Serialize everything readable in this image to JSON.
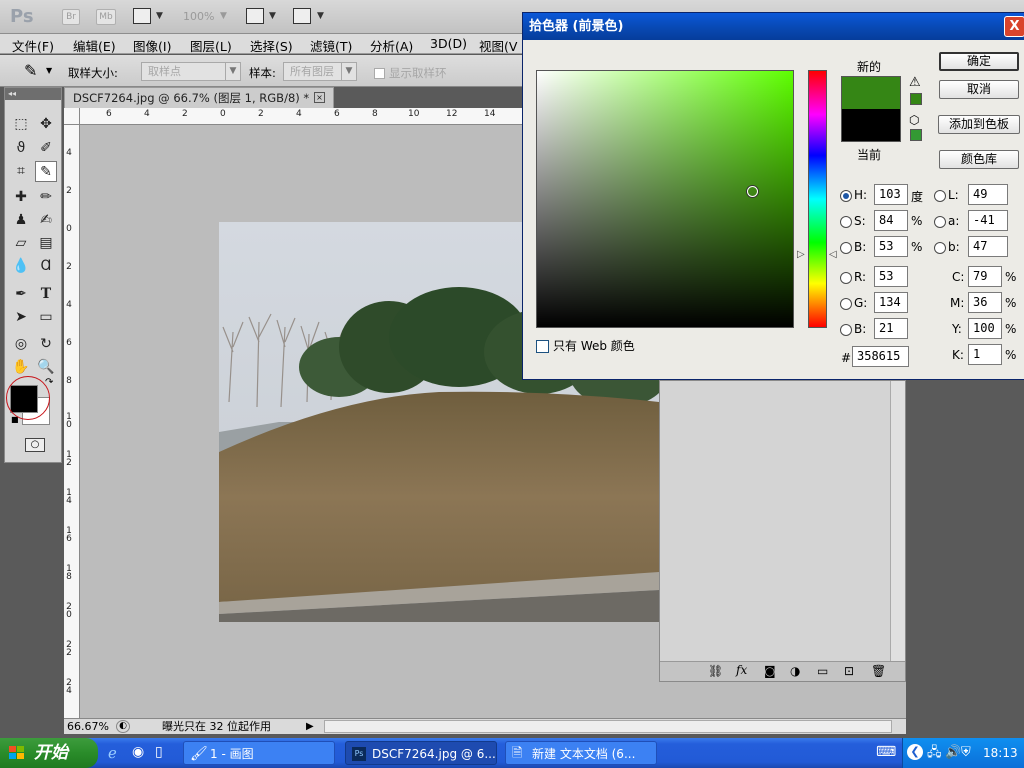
{
  "appbar": {
    "logo": "Ps",
    "btn_br": "Br",
    "btn_mb": "Mb",
    "zoom": "100%"
  },
  "menu": [
    "文件(F)",
    "编辑(E)",
    "图像(I)",
    "图层(L)",
    "选择(S)",
    "滤镜(T)",
    "分析(A)",
    "3D(D)",
    "视图(V"
  ],
  "options": {
    "sample_size_label": "取样大小:",
    "sample_size_value": "取样点",
    "sample_label": "样本:",
    "sample_value": "所有图层",
    "show_ring_label": "显示取样环"
  },
  "doc": {
    "tab_title": "DSCF7264.jpg @ 66.7% (图层 1, RGB/8) *"
  },
  "ruler": {
    "h": [
      "6",
      "4",
      "2",
      "0",
      "2",
      "4",
      "6",
      "8",
      "10",
      "12",
      "14"
    ],
    "v": [
      "4",
      "2",
      "0",
      "2",
      "4",
      "6",
      "8",
      "1\n0",
      "1\n2",
      "1\n4",
      "1\n6",
      "1\n8",
      "2\n0",
      "2\n2",
      "2\n4"
    ]
  },
  "status": {
    "zoom": "66.67%",
    "message": "曝光只在 32 位起作用"
  },
  "picker": {
    "title": "拾色器 (前景色)",
    "close": "X",
    "new_label": "新的",
    "current_label": "当前",
    "new_color": "#358615",
    "current_color": "#000000",
    "buttons": {
      "ok": "确定",
      "cancel": "取消",
      "add_swatch": "添加到色板",
      "libraries": "颜色库"
    },
    "web_only": "只有 Web 颜色",
    "h": {
      "label": "H:",
      "value": "103",
      "unit": "度"
    },
    "s": {
      "label": "S:",
      "value": "84",
      "unit": "%"
    },
    "bri": {
      "label": "B:",
      "value": "53",
      "unit": "%"
    },
    "r": {
      "label": "R:",
      "value": "53"
    },
    "g": {
      "label": "G:",
      "value": "134"
    },
    "bl": {
      "label": "B:",
      "value": "21"
    },
    "lab_l": {
      "label": "L:",
      "value": "49"
    },
    "lab_a": {
      "label": "a:",
      "value": "-41"
    },
    "lab_b": {
      "label": "b:",
      "value": "47"
    },
    "c": {
      "label": "C:",
      "value": "79",
      "unit": "%"
    },
    "m": {
      "label": "M:",
      "value": "36",
      "unit": "%"
    },
    "y": {
      "label": "Y:",
      "value": "100",
      "unit": "%"
    },
    "k": {
      "label": "K:",
      "value": "1",
      "unit": "%"
    },
    "hex_label": "#",
    "hex": "358615"
  },
  "taskbar": {
    "start": "开始",
    "tasks": [
      "1 - 画图",
      "DSCF7264.jpg @ 6...",
      "新建 文本文档 (6..."
    ],
    "time": "18:13"
  }
}
